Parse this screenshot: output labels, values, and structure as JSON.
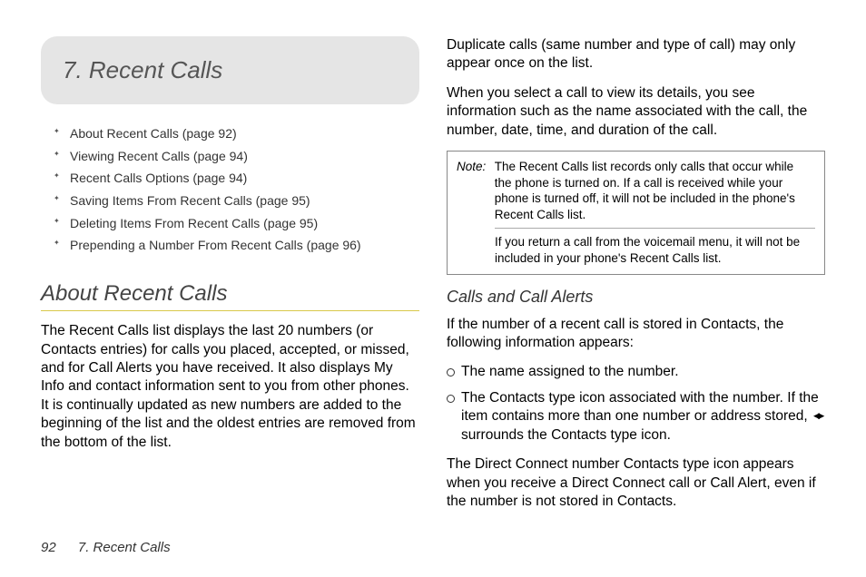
{
  "chapter": {
    "number_title": "7.   Recent Calls"
  },
  "toc": {
    "items": [
      "About Recent Calls (page 92)",
      "Viewing Recent Calls (page 94)",
      "Recent Calls Options (page 94)",
      "Saving Items From Recent Calls (page 95)",
      "Deleting Items From Recent Calls (page 95)",
      "Prepending a Number From Recent Calls (page 96)"
    ]
  },
  "left": {
    "heading": "About Recent Calls",
    "body": "The Recent Calls list displays the last 20 numbers (or Contacts entries) for calls you placed, accepted, or missed, and for Call Alerts you have received. It also displays My Info and contact information sent to you from other phones. It is continually updated as new numbers are added to the beginning of the list and the oldest entries are removed from the bottom of the list."
  },
  "right": {
    "p1": "Duplicate calls (same number and type of call) may only appear once on the list.",
    "p2": "When you select a call to view its details, you see information such as the name associated with the call, the number, date, time, and duration of the call.",
    "note": {
      "label": "Note:",
      "text1": "The Recent Calls list records only calls that occur while the phone is turned on. If a call is received while your phone is turned off, it will not be included in the phone's Recent Calls list.",
      "text2": "If you return a call from the voicemail menu, it will not be included in your phone's Recent Calls list."
    },
    "subheading": "Calls and Call Alerts",
    "p3": "If the number of a recent call is stored in Contacts, the following information appears:",
    "bullets": {
      "b1": "The name assigned to the number.",
      "b2a": "The Contacts type icon associated with the number. If the item contains more than one number or address stored, ",
      "b2b": " surrounds the Contacts type icon."
    },
    "p4": "The Direct Connect number Contacts type icon appears when you receive a Direct Connect call or Call Alert, even if the number is not stored in Contacts."
  },
  "footer": {
    "page": "92",
    "title": "7. Recent Calls"
  }
}
